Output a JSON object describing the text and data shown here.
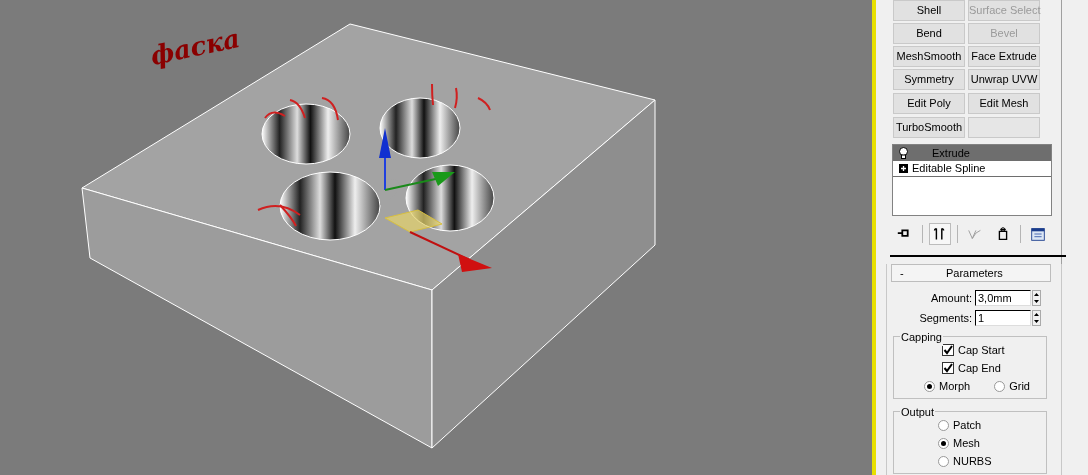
{
  "viewport": {
    "annotation": "фаска"
  },
  "modifier_buttons": [
    {
      "kind": "modifier",
      "label": "Shell",
      "disabled": false
    },
    {
      "kind": "modifier",
      "label": "Surface Select",
      "disabled": true
    },
    {
      "kind": "modifier",
      "label": "Bend",
      "disabled": false
    },
    {
      "kind": "modifier",
      "label": "Bevel",
      "disabled": true
    },
    {
      "kind": "modifier",
      "label": "MeshSmooth",
      "disabled": false
    },
    {
      "kind": "modifier",
      "label": "Face Extrude",
      "disabled": false
    },
    {
      "kind": "modifier",
      "label": "Symmetry",
      "disabled": false
    },
    {
      "kind": "modifier",
      "label": "Unwrap UVW",
      "disabled": false
    },
    {
      "kind": "modifier",
      "label": "Edit Poly",
      "disabled": false
    },
    {
      "kind": "modifier",
      "label": "Edit Mesh",
      "disabled": false
    },
    {
      "kind": "modifier",
      "label": "TurboSmooth",
      "disabled": false
    },
    {
      "kind": "blank"
    }
  ],
  "modifier_stack": [
    {
      "kind": "modifier",
      "label": "Extrude",
      "selected": true
    },
    {
      "kind": "base",
      "label": "Editable Spline",
      "selected": false
    }
  ],
  "stack_toolbar": [
    {
      "kind": "pin",
      "pressed": false
    },
    {
      "kind": "end-result",
      "pressed": true
    },
    {
      "kind": "unique",
      "pressed": false
    },
    {
      "kind": "remove",
      "pressed": false
    },
    {
      "kind": "configure",
      "pressed": false
    }
  ],
  "parameters": {
    "collapse": "-",
    "title": "Parameters",
    "spinners": [
      {
        "label": "Amount:",
        "value": "3,0mm"
      },
      {
        "label": "Segments:",
        "value": "1"
      }
    ],
    "capping": {
      "title": "Capping",
      "checkboxes": [
        {
          "label": "Cap Start",
          "checked": true
        },
        {
          "label": "Cap End",
          "checked": true
        }
      ],
      "radios": [
        {
          "label": "Morph",
          "selected": true
        },
        {
          "label": "Grid",
          "selected": false
        }
      ]
    },
    "output": {
      "title": "Output",
      "radios": [
        {
          "label": "Patch",
          "selected": false
        },
        {
          "label": "Mesh",
          "selected": true
        },
        {
          "label": "NURBS",
          "selected": false
        }
      ]
    }
  }
}
